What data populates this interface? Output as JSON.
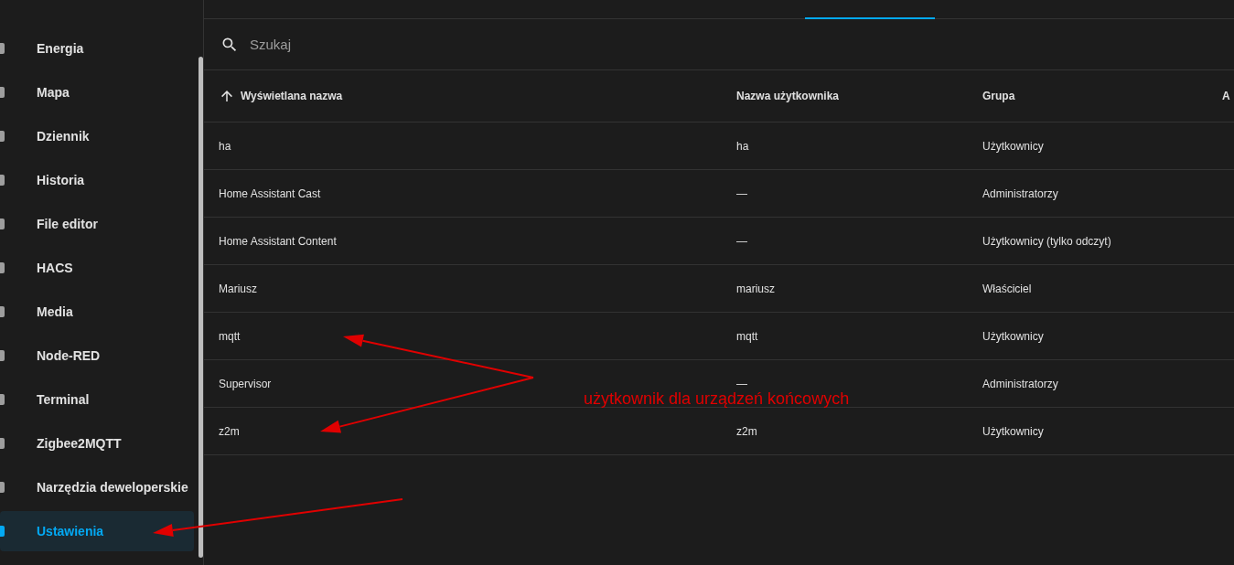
{
  "sidebar": {
    "items": [
      {
        "label": "Energia",
        "selected": false
      },
      {
        "label": "Mapa",
        "selected": false
      },
      {
        "label": "Dziennik",
        "selected": false
      },
      {
        "label": "Historia",
        "selected": false
      },
      {
        "label": "File editor",
        "selected": false
      },
      {
        "label": "HACS",
        "selected": false
      },
      {
        "label": "Media",
        "selected": false
      },
      {
        "label": "Node-RED",
        "selected": false
      },
      {
        "label": "Terminal",
        "selected": false
      },
      {
        "label": "Zigbee2MQTT",
        "selected": false
      },
      {
        "label": "Narzędzia deweloperskie",
        "selected": false
      },
      {
        "label": "Ustawienia",
        "selected": true
      }
    ]
  },
  "search": {
    "placeholder": "Szukaj"
  },
  "table": {
    "columns": [
      {
        "label": "Wyświetlana nazwa",
        "sorted": true
      },
      {
        "label": "Nazwa użytkownika",
        "sorted": false
      },
      {
        "label": "Grupa",
        "sorted": false
      },
      {
        "label": "A",
        "sorted": false
      }
    ],
    "rows": [
      [
        "ha",
        "ha",
        "Użytkownicy"
      ],
      [
        "Home Assistant Cast",
        "—",
        "Administratorzy"
      ],
      [
        "Home Assistant Content",
        "—",
        "Użytkownicy (tylko odczyt)"
      ],
      [
        "Mariusz",
        "mariusz",
        "Właściciel"
      ],
      [
        "mqtt",
        "mqtt",
        "Użytkownicy"
      ],
      [
        "Supervisor",
        "—",
        "Administratorzy"
      ],
      [
        "z2m",
        "z2m",
        "Użytkownicy"
      ]
    ]
  },
  "annotation": {
    "text": "użytkownik dla urządzeń końcowych"
  }
}
